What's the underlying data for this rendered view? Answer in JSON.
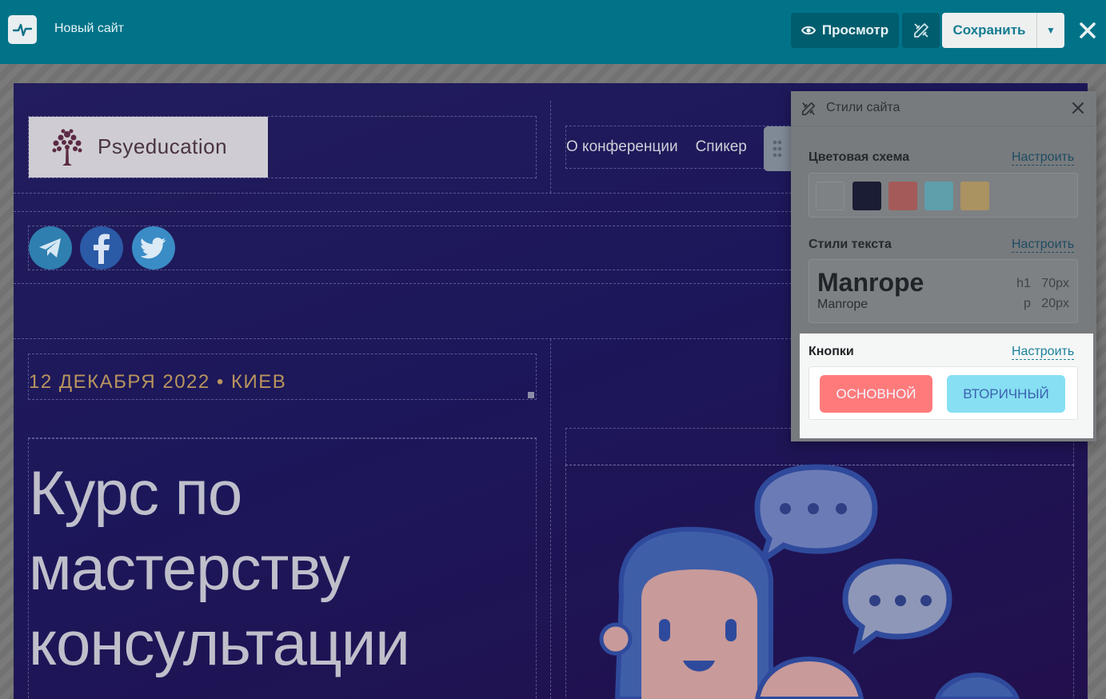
{
  "toolbar": {
    "site_name": "Новый сайт",
    "preview_label": "Просмотр",
    "save_label": "Сохранить"
  },
  "site": {
    "brand_name": "Psyeducation",
    "nav_items": [
      "О конференции",
      "Спикер"
    ],
    "event_date": "12 ДЕКАБРЯ 2022 • КИЕВ",
    "hero_title": "Курс по мастерству консультации"
  },
  "panel": {
    "title": "Стили сайта",
    "color_scheme": {
      "title": "Цветовая схема",
      "link": "Настроить",
      "swatches": [
        "#f2f2f2",
        "#1b1d34",
        "#cf6363",
        "#6cbfd3",
        "#e2b76a"
      ]
    },
    "text_styles": {
      "title": "Стили текста",
      "link": "Настроить",
      "heading_font": "Manrope",
      "body_font": "Manrope",
      "h1_tag": "h1",
      "h1_size": "70px",
      "p_tag": "p",
      "p_size": "20px"
    },
    "buttons": {
      "title": "Кнопки",
      "link": "Настроить",
      "primary_label": "ОСНОВНОЙ",
      "secondary_label": "ВТОРИЧНЫЙ"
    }
  },
  "colors": {
    "toolbar": "#007388",
    "primary_button": "#ff7b7b",
    "secondary_button": "#86dff3",
    "date_text": "#b9955d"
  }
}
